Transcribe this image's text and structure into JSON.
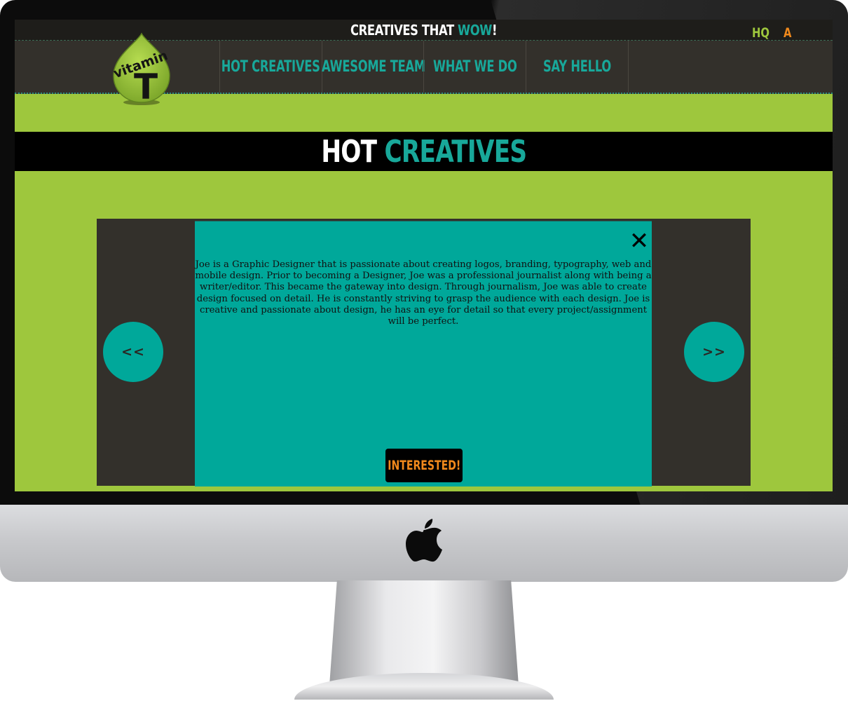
{
  "header": {
    "tagline_prefix": "CREATIVES THAT ",
    "tagline_highlight": "WOW",
    "tagline_suffix": "!",
    "hq_link": "HQ",
    "a_link": "A"
  },
  "logo": {
    "word": "vitamin",
    "letter": "T"
  },
  "nav": {
    "items": [
      {
        "label": "HOT CREATIVES"
      },
      {
        "label": "AWESOME TEAM"
      },
      {
        "label": "WHAT WE DO"
      },
      {
        "label": "SAY HELLO"
      }
    ]
  },
  "section": {
    "title_white": "HOT",
    "title_teal": "CREATIVES"
  },
  "carousel": {
    "prev_label": "<<",
    "next_label": ">>",
    "close_label": "✕",
    "bio": "Joe is a Graphic Designer that is passionate about creating logos, branding, typography, web and mobile design. Prior to becoming a Designer, Joe was a professional journalist along with being a writer/editor. This became the gateway into design. Through journalism, Joe was able to create design focused on detail. He is constantly striving to grasp the audience with each design. Joe is creative and passionate about design, he has an eye for detail so that every project/assignment will be perfect.",
    "cta_label": "INTERESTED!"
  },
  "colors": {
    "green": "#9ec73d",
    "teal": "#00a89a",
    "dark": "#33302b",
    "orange": "#f0891c",
    "black": "#000000"
  },
  "icons": {
    "brand": "apple-logo-icon",
    "close": "close-icon"
  }
}
